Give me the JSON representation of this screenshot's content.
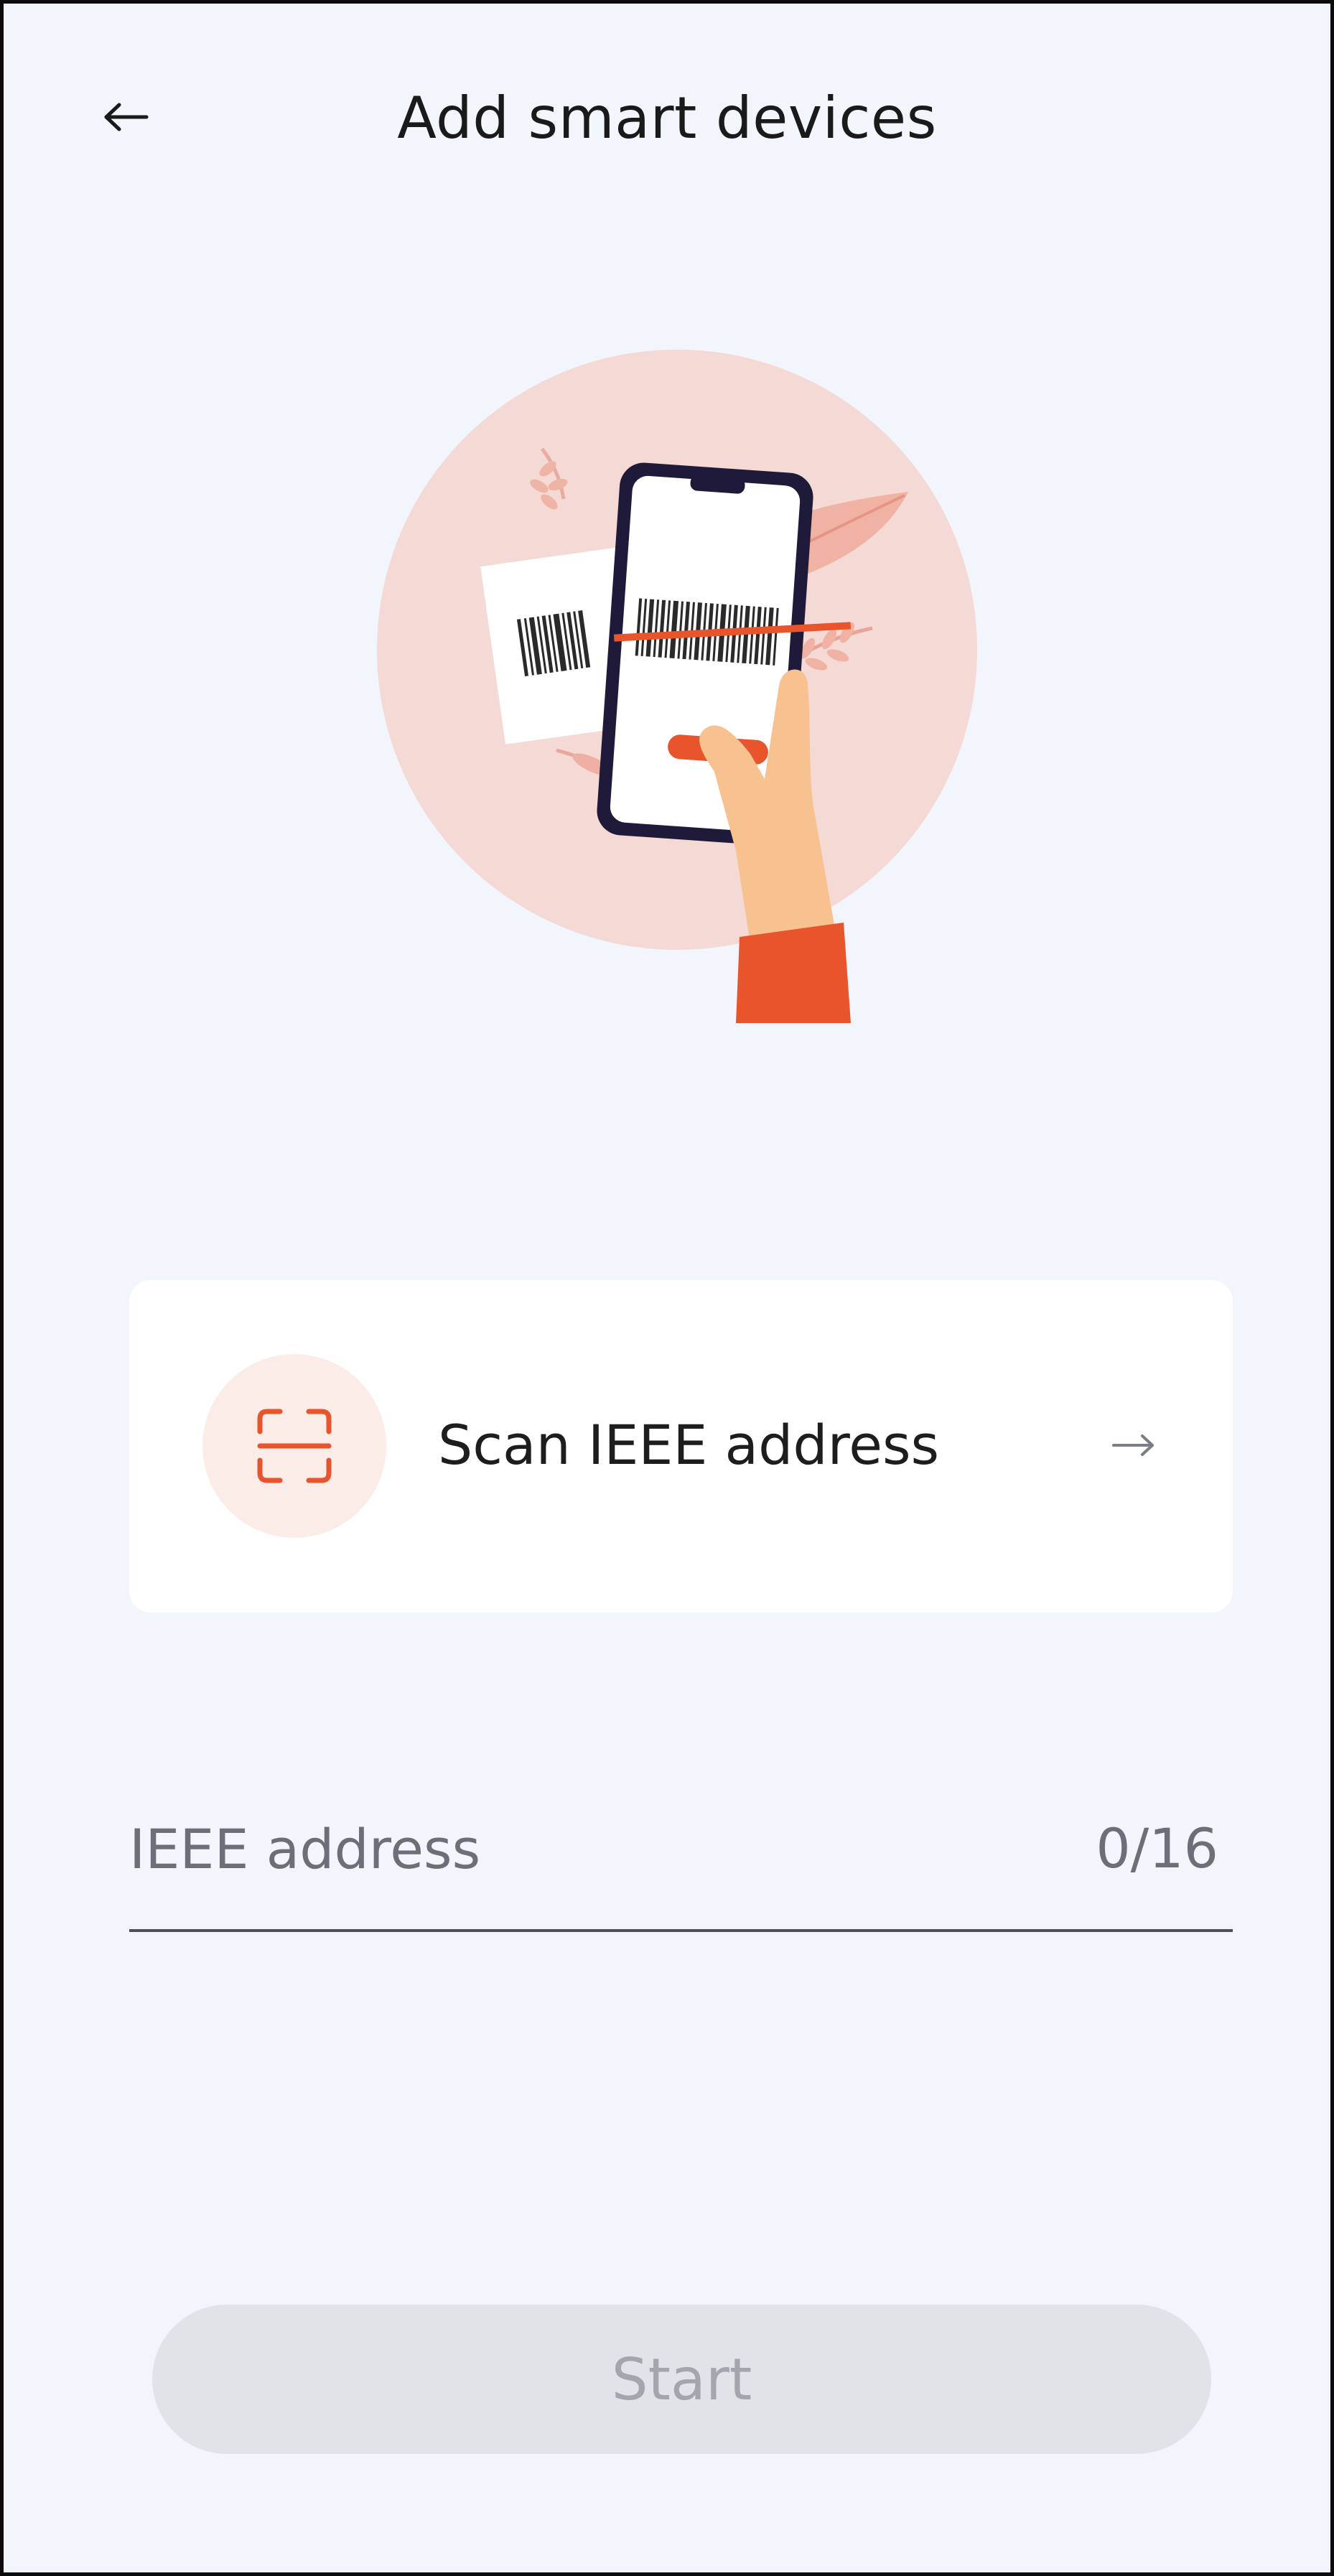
{
  "header": {
    "back_icon": "arrow-left-icon",
    "title": "Add smart devices"
  },
  "illustration": {
    "name": "phone-scanning-barcode-illustration",
    "colors": {
      "circle": "#f4d9d4",
      "accent": "#e8552c",
      "phone_frame": "#1f1a3a",
      "hand": "#f7c28f"
    }
  },
  "scan_card": {
    "icon": "scan-frame-icon",
    "label": "Scan IEEE address",
    "arrow_icon": "arrow-right-icon"
  },
  "ieee_field": {
    "placeholder": "IEEE address",
    "value": "",
    "counter": "0/16"
  },
  "start_button": {
    "label": "Start",
    "enabled": false
  },
  "colors": {
    "background": "#f2f5fb",
    "accent": "#e8552c",
    "disabled_button": "#e1e3e8",
    "disabled_text": "#a3a6ad"
  }
}
